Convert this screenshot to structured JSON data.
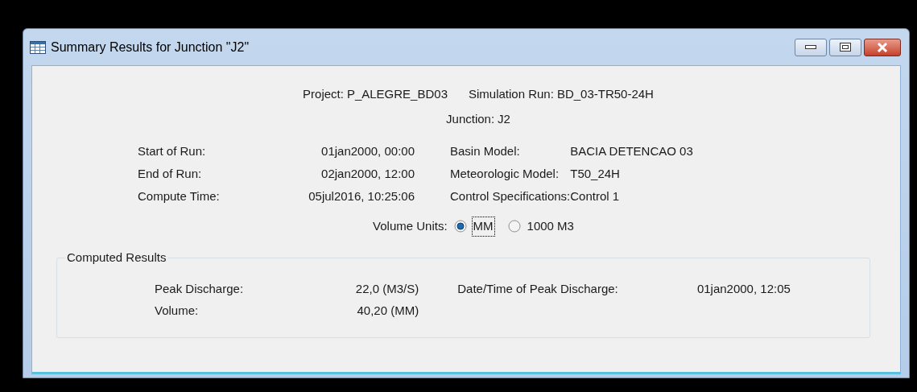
{
  "window": {
    "title": "Summary Results for Junction \"J2\""
  },
  "header": {
    "project_label": "Project:",
    "project": "P_ALEGRE_BD03",
    "run_label": "Simulation Run:",
    "run": "BD_03-TR50-24H",
    "junction_label": "Junction:",
    "junction": "J2"
  },
  "run_info": {
    "left": [
      {
        "label": "Start of Run:",
        "value": "01jan2000, 00:00"
      },
      {
        "label": "End of Run:",
        "value": "02jan2000, 12:00"
      },
      {
        "label": "Compute Time:",
        "value": "05jul2016, 10:25:06"
      }
    ],
    "right": [
      {
        "label": "Basin Model:",
        "value": "BACIA DETENCAO 03"
      },
      {
        "label": "Meteorologic Model:",
        "value": "T50_24H"
      },
      {
        "label": "Control Specifications:",
        "value": "Control 1"
      }
    ]
  },
  "volume_units": {
    "label": "Volume Units:",
    "options": [
      {
        "label": "MM",
        "selected": true,
        "focused": true
      },
      {
        "label": "1000 M3",
        "selected": false,
        "focused": false
      }
    ]
  },
  "computed_results": {
    "title": "Computed Results",
    "peak_label": "Peak Discharge:",
    "peak": "22,0 (M3/S)",
    "volume_label": "Volume:",
    "volume": "40,20 (MM)",
    "peak_time_label": "Date/Time of Peak Discharge:",
    "peak_time": "01jan2000, 12:05"
  }
}
